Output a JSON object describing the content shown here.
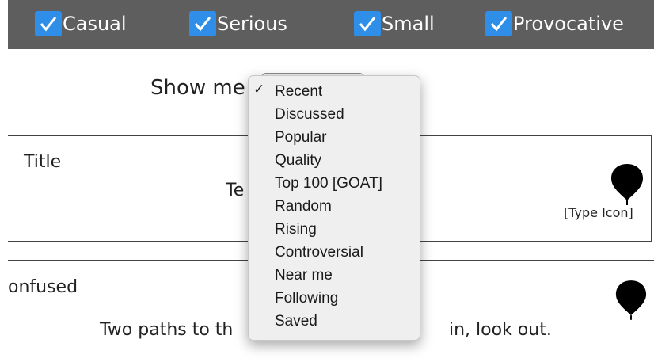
{
  "filters": [
    {
      "label": "Casual",
      "checked": true
    },
    {
      "label": "Serious",
      "checked": true
    },
    {
      "label": "Small",
      "checked": true
    },
    {
      "label": "Provocative",
      "checked": true
    }
  ],
  "show_me": {
    "label": "Show me",
    "options": [
      "Recent",
      "Discussed",
      "Popular",
      "Quality",
      "Top 100 [GOAT]",
      "Random",
      "Rising",
      "Controversial",
      "Near me",
      "Following",
      "Saved"
    ],
    "selected": "Recent",
    "check_glyph": "✓"
  },
  "cards": [
    {
      "title": "Title",
      "text_fragment": "Te",
      "type_icon_label": "[Type Icon]",
      "icon": "balloon-pin-icon"
    },
    {
      "title": "onfused",
      "body_left": "Two paths to th",
      "body_right": "in, look out.",
      "icon": "balloon-pin-icon"
    }
  ],
  "colors": {
    "topbar": "#5e5e5e",
    "checkbox": "#2f8fe8"
  }
}
